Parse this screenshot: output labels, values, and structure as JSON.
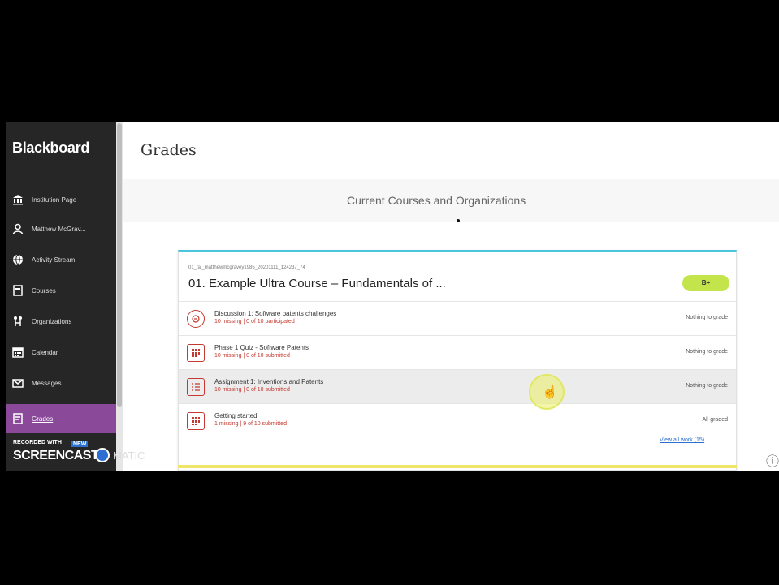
{
  "sidebar": {
    "brand": "Blackboard",
    "items": [
      {
        "label": "Institution Page",
        "icon": "institution-icon"
      },
      {
        "label": "Matthew McGrav...",
        "icon": "person-icon"
      },
      {
        "label": "Activity Stream",
        "icon": "globe-icon"
      },
      {
        "label": "Courses",
        "icon": "courses-icon"
      },
      {
        "label": "Organizations",
        "icon": "organizations-icon"
      },
      {
        "label": "Calendar",
        "icon": "calendar-icon"
      },
      {
        "label": "Messages",
        "icon": "messages-icon"
      },
      {
        "label": "Grades",
        "icon": "grades-icon",
        "active": true
      }
    ]
  },
  "header": {
    "title": "Grades",
    "section_title": "Current Courses and Organizations"
  },
  "course": {
    "id": "01_fal_matthewmcgravey1985_20201111_124237_74",
    "name": "01. Example Ultra Course – Fundamentals of ...",
    "badge": "B+",
    "view_all": "View all work (15)",
    "rows": [
      {
        "title": "Discussion 1: Software patents challenges",
        "sub": "10 missing | 0 of 10 participated",
        "status": "Nothing to grade",
        "icon": "discussion-icon"
      },
      {
        "title": "Phase 1 Quiz - Software Patents",
        "sub": "10 missing | 0 of 10 submitted",
        "status": "Nothing to grade",
        "icon": "quiz-icon"
      },
      {
        "title": "Assignment 1: Inventions and Patents",
        "sub": "10 missing | 0 of 10 submitted",
        "status": "Nothing to grade",
        "icon": "assignment-icon"
      },
      {
        "title": "Getting started",
        "sub": "1 missing | 9 of 10 submitted",
        "status": "All graded",
        "icon": "test-icon"
      }
    ]
  },
  "watermark": {
    "recorded_with": "RECORDED WITH",
    "brand": "SCREENCAST",
    "badge": "NEW",
    "suffix": "MATIC"
  },
  "colors": {
    "sidebar_bg": "#262626",
    "active_item": "#8a4a99",
    "card_accent": "#4ac7dd",
    "grade_badge": "#c3e44b",
    "item_icon": "#c4382f"
  }
}
